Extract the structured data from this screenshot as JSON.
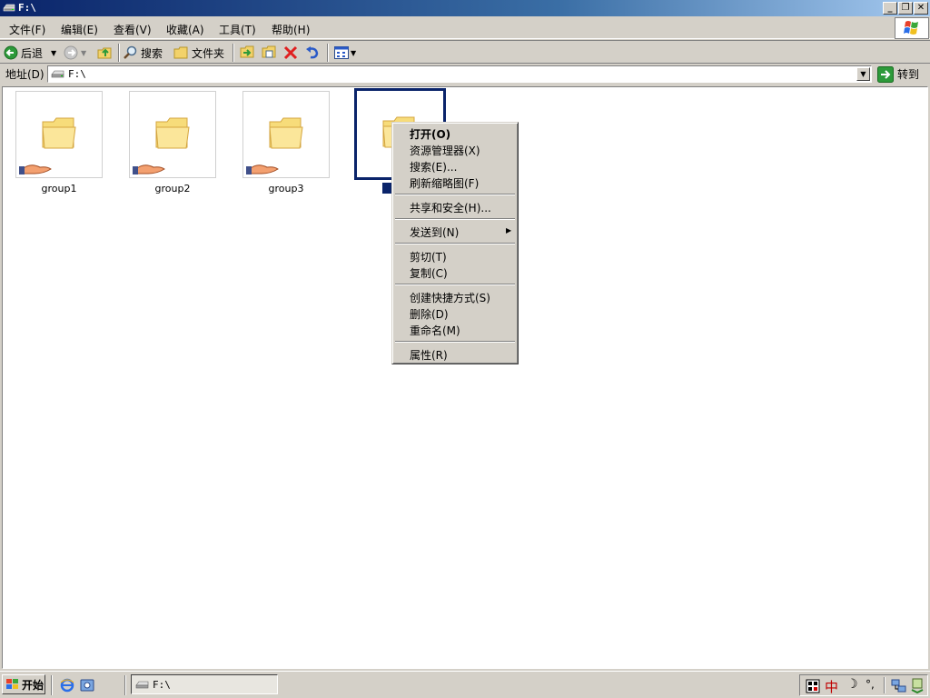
{
  "window": {
    "title": "F:\\",
    "buttons": {
      "minimize": "_",
      "restore": "❐",
      "close": "✕"
    }
  },
  "menubar": [
    {
      "label": "文件(F)"
    },
    {
      "label": "编辑(E)"
    },
    {
      "label": "查看(V)"
    },
    {
      "label": "收藏(A)"
    },
    {
      "label": "工具(T)"
    },
    {
      "label": "帮助(H)"
    }
  ],
  "toolbar": {
    "back_label": "后退",
    "search_label": "搜索",
    "folders_label": "文件夹"
  },
  "address": {
    "label": "地址(D)",
    "value": "F:\\",
    "go_label": "转到"
  },
  "folders": [
    {
      "name": "group1"
    },
    {
      "name": "group2"
    },
    {
      "name": "group3"
    },
    {
      "name": ""
    }
  ],
  "context_menu": [
    {
      "label": "打开(O)",
      "bold": true
    },
    {
      "label": "资源管理器(X)"
    },
    {
      "label": "搜索(E)..."
    },
    {
      "label": "刷新缩略图(F)"
    },
    {
      "label": "共享和安全(H)..."
    },
    {
      "label": "发送到(N)"
    },
    {
      "label": "剪切(T)"
    },
    {
      "label": "复制(C)"
    },
    {
      "label": "创建快捷方式(S)"
    },
    {
      "label": "删除(D)"
    },
    {
      "label": "重命名(M)"
    },
    {
      "label": "属性(R)"
    }
  ],
  "taskbar": {
    "start_label": "开始",
    "task_label": "F:\\",
    "tray_ime": "中",
    "tray_punct": "°,"
  },
  "colors": {
    "title_gradient_start": "#0a246a",
    "title_gradient_end": "#a6caf0",
    "selection": "#0a246a",
    "chrome": "#d4d0c8"
  }
}
